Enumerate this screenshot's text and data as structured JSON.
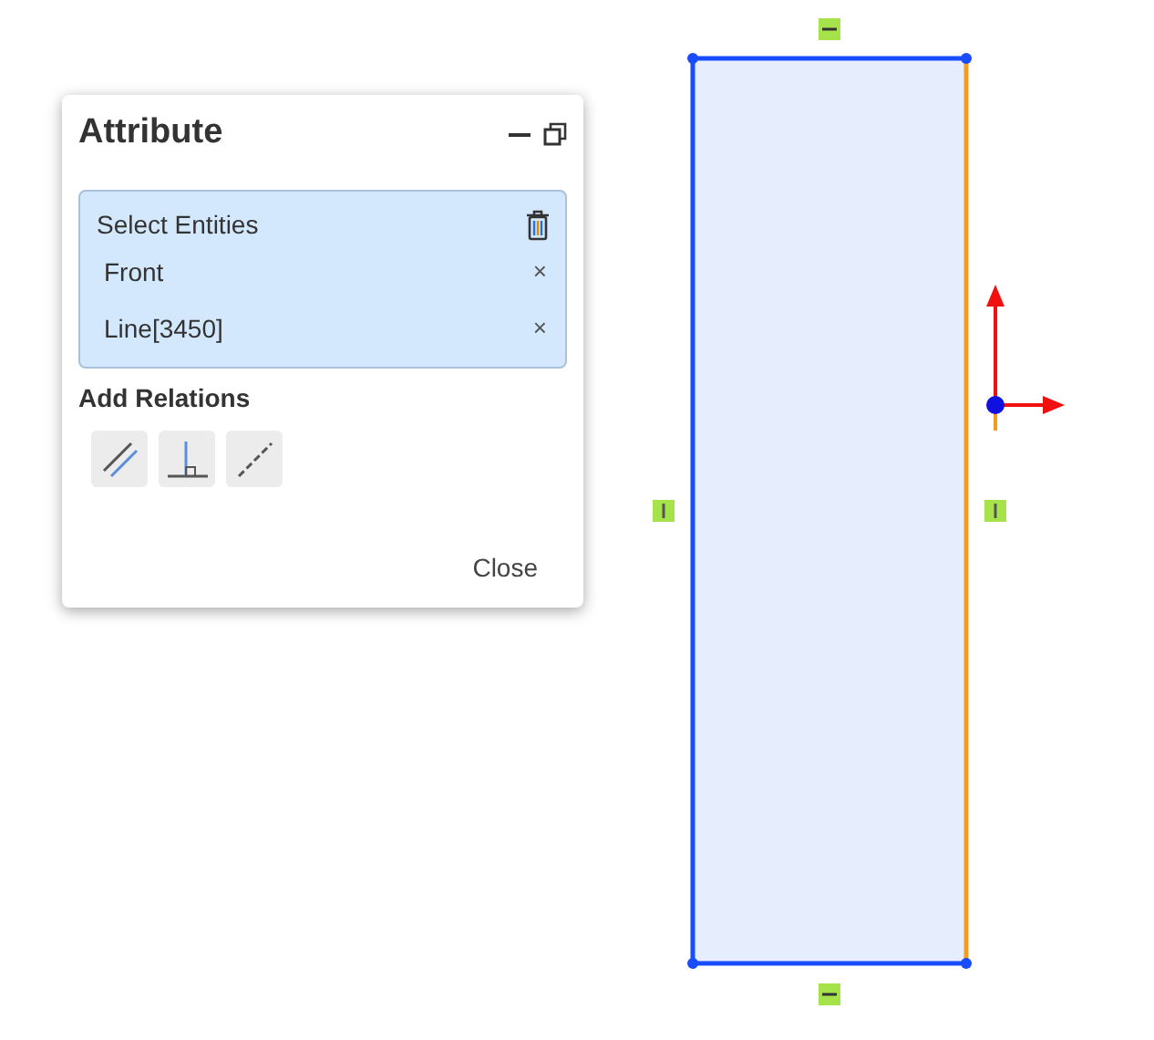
{
  "panel": {
    "title": "Attribute",
    "select_box": {
      "label": "Select Entities",
      "entities": [
        {
          "name": "Front",
          "remove": "×"
        },
        {
          "name": "Line[3450]",
          "remove": "×"
        }
      ]
    },
    "relations_label": "Add Relations",
    "relations": [
      {
        "kind": "parallel"
      },
      {
        "kind": "perpendicular"
      },
      {
        "kind": "collinear"
      }
    ],
    "close": "Close"
  },
  "sketch": {
    "edges": [
      {
        "kind": "top",
        "selected": false,
        "constraint": {
          "kind": "horizontal"
        }
      },
      {
        "kind": "right",
        "selected": true,
        "constraint": {
          "kind": "vertical"
        }
      },
      {
        "kind": "bottom",
        "selected": false,
        "constraint": {
          "kind": "horizontal"
        }
      },
      {
        "kind": "left",
        "selected": false,
        "constraint": {
          "kind": "vertical"
        }
      }
    ]
  }
}
